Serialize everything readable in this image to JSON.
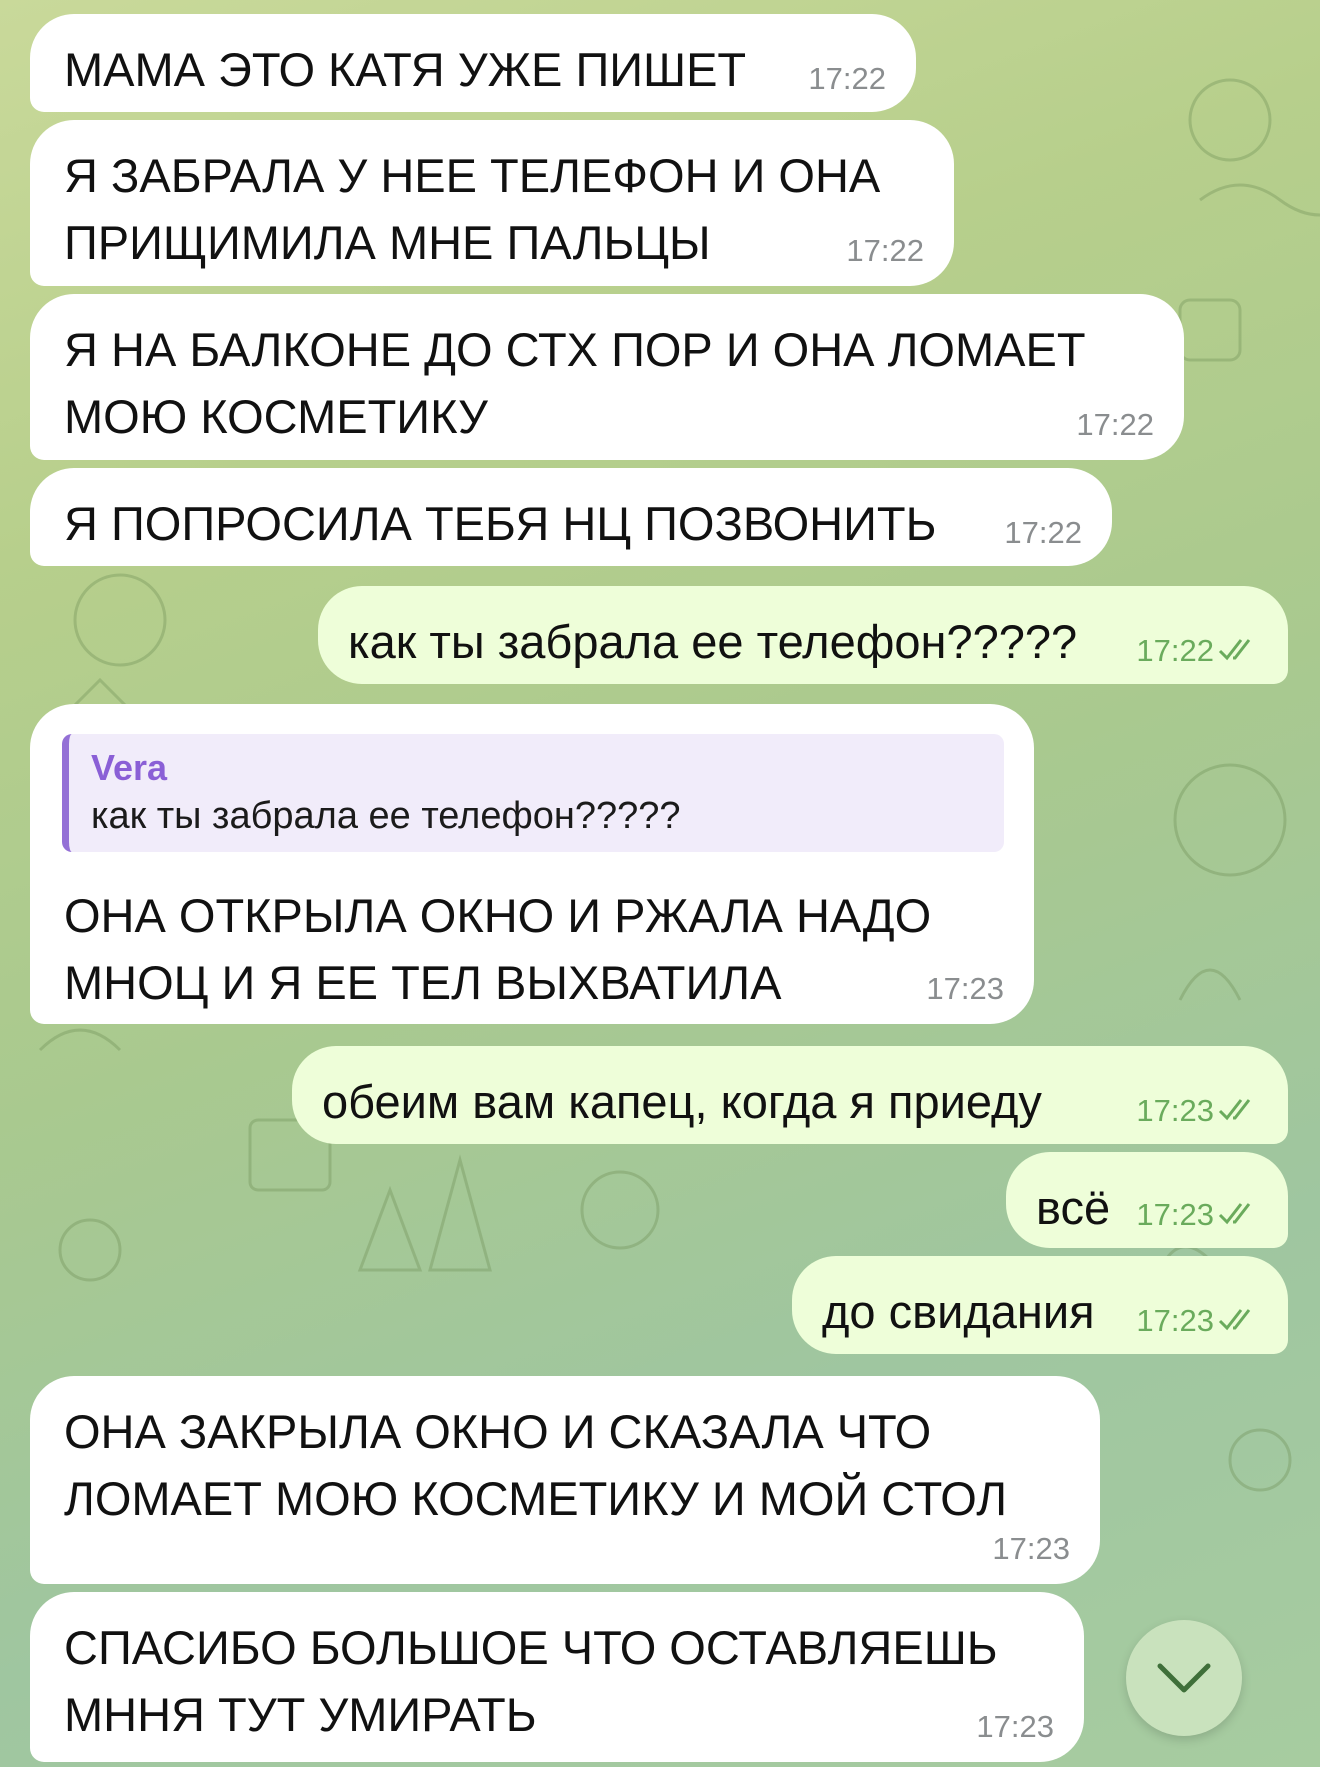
{
  "messages": [
    {
      "id": 1,
      "direction": "in",
      "text": "МАМА ЭТО КАТЯ УЖЕ ПИШЕТ",
      "time": "17:22"
    },
    {
      "id": 2,
      "direction": "in",
      "text": "Я ЗАБРАЛА У НЕЕ ТЕЛЕФОН И ОНА ПРИЩИМИЛА МНЕ ПАЛЬЦЫ",
      "time": "17:22"
    },
    {
      "id": 3,
      "direction": "in",
      "text": "Я НА БАЛКОНЕ ДО СТХ ПОР И ОНА ЛОМАЕТ МОЮ КОСМЕТИКУ",
      "time": "17:22"
    },
    {
      "id": 4,
      "direction": "in",
      "text": "Я ПОПРОСИЛА ТЕБЯ НЦ ПОЗВОНИТЬ",
      "time": "17:22"
    },
    {
      "id": 5,
      "direction": "out",
      "text": "как ты забрала ее телефон?????",
      "time": "17:22",
      "status": "read"
    },
    {
      "id": 6,
      "direction": "in",
      "text": "ОНА ОТКРЫЛА ОКНО И РЖАЛА НАДО МНОЦ И Я ЕЕ ТЕЛ ВЫХВАТИЛА",
      "time": "17:23",
      "reply": {
        "author": "Vera",
        "text": "как ты забрала ее телефон?????"
      }
    },
    {
      "id": 7,
      "direction": "out",
      "text": "обеим вам капец, когда я приеду",
      "time": "17:23",
      "status": "read"
    },
    {
      "id": 8,
      "direction": "out",
      "text": "всё",
      "time": "17:23",
      "status": "read"
    },
    {
      "id": 9,
      "direction": "out",
      "text": "до свидания",
      "time": "17:23",
      "status": "read"
    },
    {
      "id": 10,
      "direction": "in",
      "text": "ОНА ЗАКРЫЛА ОКНО И СКАЗАЛА ЧТО ЛОМАЕТ МОЮ КОСМЕТИКУ И МОЙ СТОЛ",
      "time": "17:23"
    },
    {
      "id": 11,
      "direction": "in",
      "text": "СПАСИБО БОЛЬШОЕ ЧТО ОСТАВЛЯЕШЬ МННЯ ТУТ УМИРАТЬ",
      "time": "17:23"
    }
  ],
  "scroll_down_button": {
    "icon": "chevron-down-icon"
  },
  "colors": {
    "incoming_bubble": "#ffffff",
    "outgoing_bubble": "#eefed9",
    "outgoing_meta": "#6aab5c",
    "reply_accent": "#9470d6"
  }
}
